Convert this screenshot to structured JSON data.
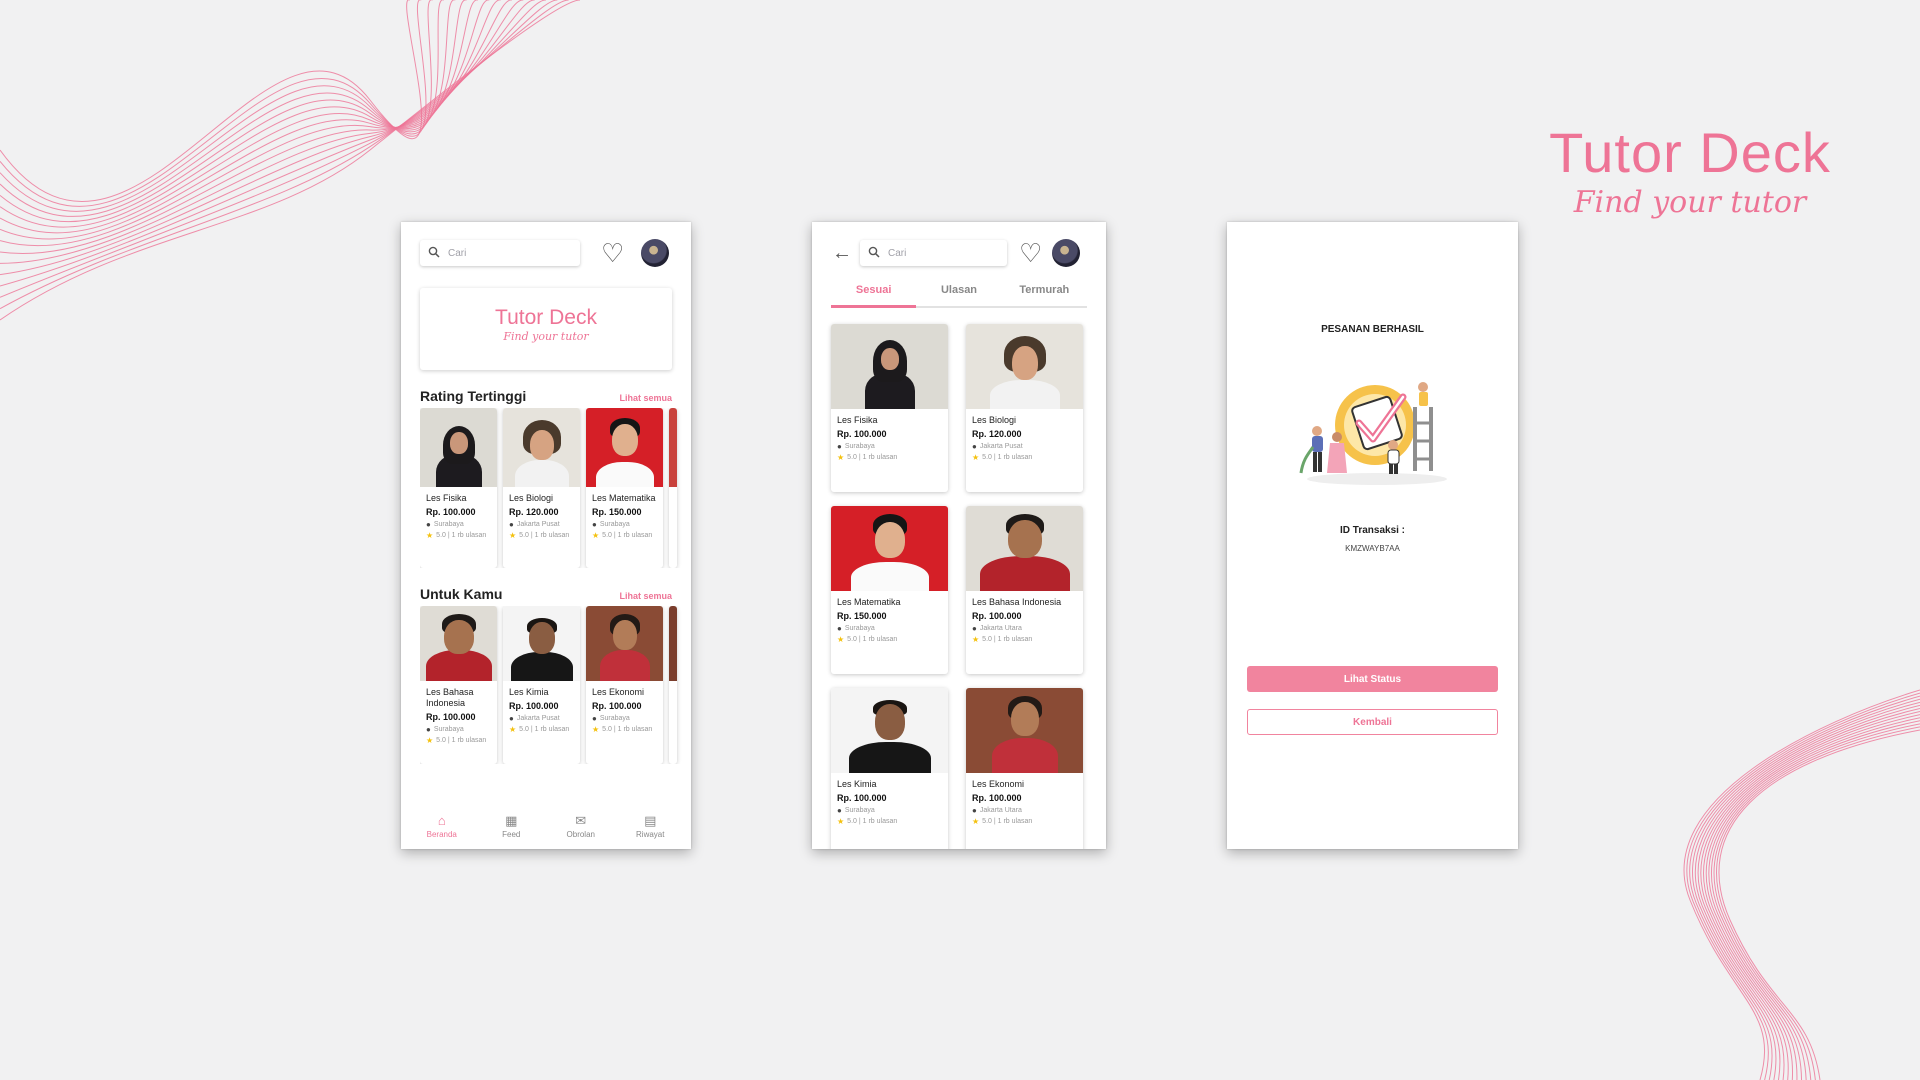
{
  "brand": {
    "title": "Tutor Deck",
    "subtitle": "Find your tutor"
  },
  "colors": {
    "accent": "#ee7496",
    "background": "#f1f1f2",
    "star": "#f4c10e"
  },
  "home": {
    "search_placeholder": "Cari",
    "icons": [
      "search-icon",
      "heart-icon",
      "avatar"
    ],
    "banner": {
      "title": "Tutor Deck",
      "subtitle": "Find your tutor"
    },
    "sections": [
      {
        "title": "Rating Tertinggi",
        "see_all": "Lihat semua",
        "cards": [
          {
            "title": "Les Fisika",
            "price": "Rp. 100.000",
            "location": "Surabaya",
            "rating": "5.0 | 1 rb ulasan"
          },
          {
            "title": "Les Biologi",
            "price": "Rp. 120.000",
            "location": "Jakarta Pusat",
            "rating": "5.0 | 1 rb ulasan"
          },
          {
            "title": "Les Matematika",
            "price": "Rp. 150.000",
            "location": "Surabaya",
            "rating": "5.0 | 1 rb ulasan"
          }
        ]
      },
      {
        "title": "Untuk Kamu",
        "see_all": "Lihat semua",
        "cards": [
          {
            "title": "Les Bahasa Indonesia",
            "price": "Rp. 100.000",
            "location": "Surabaya",
            "rating": "5.0 | 1 rb ulasan"
          },
          {
            "title": "Les Kimia",
            "price": "Rp. 100.000",
            "location": "Jakarta Pusat",
            "rating": "5.0 | 1 rb ulasan"
          },
          {
            "title": "Les Ekonomi",
            "price": "Rp. 100.000",
            "location": "Surabaya",
            "rating": "5.0 | 1 rb ulasan"
          }
        ]
      }
    ],
    "nav": [
      {
        "label": "Beranda",
        "icon": "home-icon",
        "active": true
      },
      {
        "label": "Feed",
        "icon": "chart-icon",
        "active": false
      },
      {
        "label": "Obrolan",
        "icon": "mail-icon",
        "active": false
      },
      {
        "label": "Riwayat",
        "icon": "history-icon",
        "active": false
      }
    ]
  },
  "results": {
    "search_placeholder": "Cari",
    "tabs": [
      {
        "label": "Sesuai",
        "active": true
      },
      {
        "label": "Ulasan",
        "active": false
      },
      {
        "label": "Termurah",
        "active": false
      }
    ],
    "cards": [
      {
        "title": "Les Fisika",
        "price": "Rp. 100.000",
        "location": "Surabaya",
        "rating": "5.0 | 1 rb ulasan"
      },
      {
        "title": "Les Biologi",
        "price": "Rp. 120.000",
        "location": "Jakarta Pusat",
        "rating": "5.0 | 1 rb ulasan"
      },
      {
        "title": "Les Matematika",
        "price": "Rp. 150.000",
        "location": "Surabaya",
        "rating": "5.0 | 1 rb ulasan"
      },
      {
        "title": "Les Bahasa Indonesia",
        "price": "Rp. 100.000",
        "location": "Jakarta Utara",
        "rating": "5.0 | 1 rb ulasan"
      },
      {
        "title": "Les Kimia",
        "price": "Rp. 100.000",
        "location": "Surabaya",
        "rating": "5.0 | 1 rb ulasan"
      },
      {
        "title": "Les Ekonomi",
        "price": "Rp. 100.000",
        "location": "Jakarta Utara",
        "rating": "5.0 | 1 rb ulasan"
      }
    ]
  },
  "success": {
    "title": "PESANAN BERHASIL",
    "transaction_label": "ID Transaksi :",
    "transaction_id": "KMZWAYB7AA",
    "primary_button": "Lihat Status",
    "secondary_button": "Kembali"
  }
}
